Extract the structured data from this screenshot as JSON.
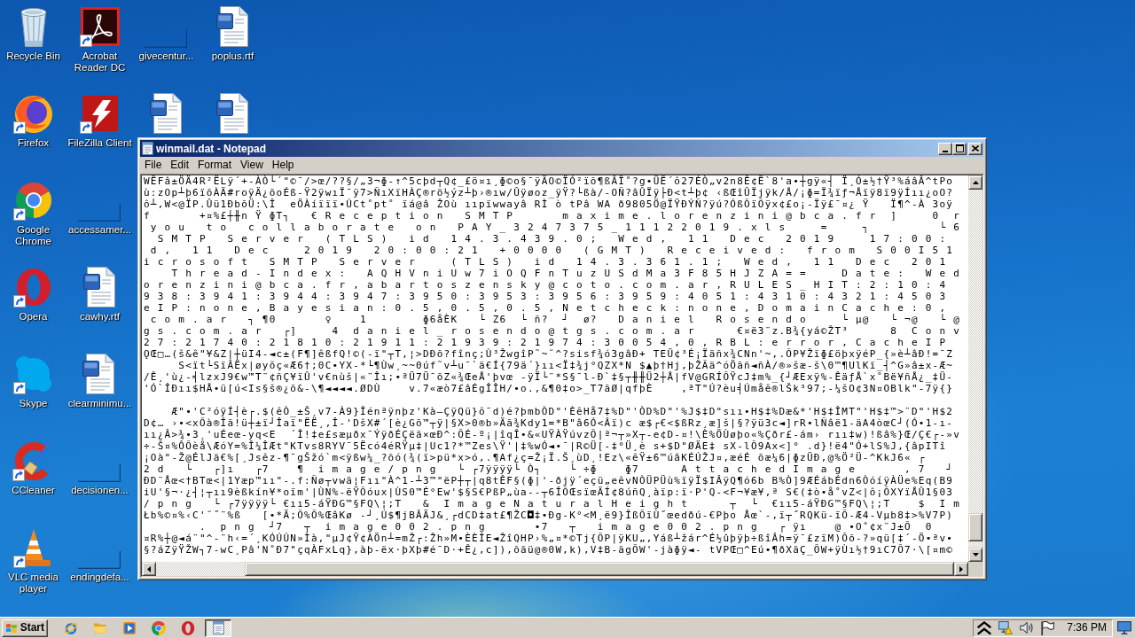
{
  "desktop_columns": [
    {
      "icons": [
        {
          "label": "Recycle Bin",
          "kind": "recycle-bin",
          "shortcut": false
        },
        {
          "label": "Firefox",
          "kind": "firefox",
          "shortcut": true
        },
        {
          "label": "Google Chrome",
          "kind": "chrome",
          "shortcut": true
        },
        {
          "label": "Opera",
          "kind": "opera",
          "shortcut": true
        },
        {
          "label": "Skype",
          "kind": "skype",
          "shortcut": true
        },
        {
          "label": "CCleaner",
          "kind": "ccleaner",
          "shortcut": true
        },
        {
          "label": "VLC media player",
          "kind": "vlc",
          "shortcut": true
        }
      ]
    },
    {
      "icons": [
        {
          "label": "Acrobat Reader DC",
          "kind": "acrobat",
          "shortcut": true
        },
        {
          "label": "FileZilla Client",
          "kind": "filezilla",
          "shortcut": true
        },
        {
          "label": "accessamer...",
          "kind": "blank",
          "shortcut": false
        },
        {
          "label": "cawhy.rtf",
          "kind": "document",
          "shortcut": false
        },
        {
          "label": "clearminimu...",
          "kind": "document",
          "shortcut": false
        },
        {
          "label": "decisionen...",
          "kind": "blank",
          "shortcut": false
        },
        {
          "label": "endingdefa...",
          "kind": "blank",
          "shortcut": false
        }
      ]
    },
    {
      "icons": [
        {
          "label": "givecentur...",
          "kind": "blank",
          "shortcut": false
        },
        {
          "kind": "document",
          "shortcut": false
        }
      ]
    },
    {
      "icons": [
        {
          "label": "poplus.rtf",
          "kind": "document",
          "shortcut": false
        },
        {
          "kind": "document",
          "shortcut": false
        }
      ]
    }
  ],
  "notepad": {
    "title": "winmail.dat - Notepad",
    "menu": [
      "File",
      "Edit",
      "Format",
      "View",
      "Help"
    ],
    "paragraphs": [
      {
        "lines": [
          "WËFâ±ÖÄ4R²ËLÿ´+-ÀÒ└´\"©¯/>œ/??§/„3¬ɸ-↑^5cþd┬Q¢_£ö¤ı¸ɸ©o§¯ÿÄO©ÏÓ²ïõ¶ßÂÏ˚?g•ÜË´ô27ÉÒ„v2n8Ê¢Ë`8'a•┼gÿ«┤ Ï¸Ó±½†Ÿ³%áâÂ^tPo",
          "ù:zOp┴þ6ïõÀÄ#roÿÄ¿õoÉß-Ÿ2ÿwıÏ¯ÿ7>ÑıXïHÀÇ®rö½ýz┴þ›®ıw/Ûÿøoz_ÿŸ?└ßà/-OÑ?âÛÏÿ├Ð<t┴þ¢ ‹ßŒîÛÏjÿk/Å/¡ɸ=Ï¾ïƒ¬Åïÿ8ï9ÿÍıı¿oO?",
          "ô┴,W<@ÏP.Ûü1ÐbõÜ:\\Î  eÖÀíïïï•ÚCt˚pt˚ ïá@â ŽOù ııpïwwayâ RÌ ò tPâ WA ð9805Ö@ÏŸÐÝÑ?ÿú?ÓßÕïÕÿx¢£o¡-Ïÿ£¯¤¿ Ÿ   Ï¶^-À 3oÿ",
          "f       +¤%£┼╫n Ÿ ɸT┐   € R e c e p t i o n   S M T P       m a x i m e . l o r e n z i n i @ b c a . f r  ]     0  r",
          " y o u   t o   c o l l a b o r a t e   o n   P A Y _ 3 2 4 7 3 7 5 _ 1 1 1 2 2 0 1 9 . x l s     =     ┐          └ 6",
          "  S M T P   S e r v e r   ( T L S )   i d   1 4 . 3 . 4 3 9 . 0 ;   W e d ,   1 1   D e c   2 0 1 9     1 7 : 0 0 :",
          " d ,   1 1   D e c     2 0 1 9   2 0 : 0 0 : 2 1   + 0 0 0 0   ( G M T )   R e c e i v e d :   f r o m   S 0 0 I 5 1",
          "i c r o s o f t   S M T P   S e r v e r     ( T L S )   i d   1 4 . 3 . 3 6 1 . 1 ;   W e d ,   1 1   D e c   2 0 1",
          "    T h r e a d - I n d e x :   A Q H V n i U w 7 i O Q F n T u z U S d M a 3 F 8 5 H J Z A = =     D a t e :   W e d",
          "o r e n z i n i @ b c a . f r , a b a r t o s z e n s k y @ c o t o . c o m . a r , R U L E S _ H I T : 2 : 1 0 : 4",
          "9 3 8 : 3 9 4 1 : 3 9 4 4 : 3 9 4 7 : 3 9 5 0 : 3 9 5 3 : 3 9 5 6 : 3 9 5 9 : 4 0 5 1 : 4 3 1 0 : 4 3 2 1 : 4 5 0 3",
          "e I P : n o n e , B a y e s i a n : 0 . 5 , 0 . 5 , 0 . 5 , N e t c h e c k : n o n e , D o m a i n C a c h e : 0 ,",
          " c o m . a r   ┐ ¶0       ♀    1        ɸ6åÈK   └ Z6  └ ñ?  ┘  ø?   D a n i e l   R o s e n d o     └ µ@   └ ¬@   └ @",
          "g s . c o m . a r   ┌]     4  d a n i e l _ r o s e n d o @ t g s . c o m . a r      €¤ë3¨z.B¾{yá©ŽT³      8  C o n v",
          "2 7 : 2 1 7 4 0 : 2 1 8 1 0 : 2 1 9 1 1 : 2 1 9 3 9 : 2 1 9 7 4 : 3 0 0 5 4 , 0 , R B L : e r r o r , C a c h e I P",
          "ǪŒ□…(š&ê\"¥&Z|┼üI4-◄c±(F¶]êßfQ!©(-ï\"┬T,¦>DÐõ?fînç;Ù³ŽwgîP˜~˘^?sisf¾ó3gâÐ+ TEÜ¢³É¡Ïäñx¾CNn'~,.ÕP¥Žïɸ£öþxÿéP_{»è┴âÐ!=¯Z",
          "     S<ït└SïÂËx|øyŏç«Æ6†;0C•YX-*└¶Ùw¸~~0úf˜v┴u¯`ä€Í{79ä´}ıı<Ï‡¾j°QZX*N $▲þ†Hj,þŽÃä^óÖãñ◄ñÀ/®»šæ-š\\0™¶UlKï_┤^G»â±x-Æ~",
          "/Ê¸'ù¿-╡lzxJ9€w™T¨¢ñÇ¥ïÛ'v€nùš|«¨Îı;•ªÜ7Ü¯õZ«¾ŒeÅ'þvœ -ÿÏ└¨*S§¯l-Ð`‡§┬╫╫Ü2┼Å|fV@GRÍÕŸcJ‡m%_{┘ÆExÿ%-ÊäƒÅ`x˚Bë¥ñÅ¿_‡Ü-",
          "'Ó`ÎÐıı$HÅ•ü[ú<Is§š®¿õ&-\\¶◄◄◄◄.ØDÙ    v.7«æò7£âÉgÎÎH/•o.,&¶0‡o>_T7ãØ|qfþÈ    ,ªT\"Ú?èu╡Úmåê®lŠk³97;-¼šO¢3N¤OBlk\"-7ÿ{}"
        ]
      },
      {
        "lines": [
          "    Æ\"•'C²óÿÍ┤è┌.$(êÒ_±Š¸v7-À9}Îénªÿnþz'Kà—ÇÿQü}ô¯d)é?þmbÒD\"'ÈêHå7‡%D\"'ÒD%D\"'%J$‡D\"sıı•H$‡%Dæ&*'H$‡ÎMT\"'H$‡™>¨D\"'H$2",
          "D¢… ›•<xÕà®Îã!ü┼±ï┘Îaï\"ËË¸,Î-'DšX#´[è¿Gõ™┬ÿ|§X>0®b»Äã¾Kdy1=*B\"â6Ó<Âï)c æ$┌€<$ßRz¸æ]š|§?ÿü3c◄]rR•lÑâë1-äA4òœC┘(Ó•1-ı-",
          "ıı¿Â>¾•3¸'uÉeœ-yq<E  ´Î!‡e£sæµðx¯ÝÿðÉÇëä×œÐ^:ÕÉ-º¡|îqÎ•&«UŸÀŸúvzÕ|ª¬┬»X┬-e¢D-¤!\\È%ÖÙøþo«%Çðr£-ám› rıı‡w)!ßâ%}Œ/Ç€┌-»v",
          "÷-Š¤%ÔÕèå\\ÆóY=%Î¼ÎÆt\"KTvs8RYV¯5Ëcó4éRŸµ‡|Uc1?*™Zes\\Ÿ'|‡%wÓ◄•¯|R©Ü[-‡°Ü¸è s+$D\"ØÄE‡ sX-lÕ9Ax<]° .d}!ë4\"Ó+lS%J,{âpITî",
          "¡Oà\"-Ž@ÉlJä€%[¸Jsêz-¶¯gŠžó`m<ÿßw¼_?õó(¾(ï>pü*x>ó,.¶Af¿ç=Ž¡Ï.Š¸ùD¸!Ez\\«êŸ±6™úâKÉÚŽJ¤,æéÉ õæ¼6|ɸzÜÐ,@%Ö²Ü-^KkJ6« ┌",
          "2 d   └   ┌]ı   ┌7    ¶  i m a g e / p n g   └ ┌7ÿÿÿÿ└ Ò┐    └ ÷ɸ    ɸ7      A t t a c h e d I m a g e       , 7   ┘",
          "ÐD¨Åœ<†BTœ<|1Yæp™ıı\"-.f:Ñø┬vwä¦Fıı\"À^1-┴3™\"ëP┼┬|q8tÊF§(ɸ|'-ðjÿ´eçü„eêvNÒÜPÜù%ïÿÏ$IÂÿQ¶ó6b B%Ò]9ÆÉábÉdn6ÒóíÿÀÜe%Eq(B9",
          "iU'§¬·¿┤¦┬ıı9èßkín¥*oïm'|ÙN%-ëŸÕóux|ÙS0™É°Ew'$§S€PßP„ùa--┬6ÎÕŒsïœÄÍ¢8úñQ¸àïp:ï·P'Q-<F¬¥æ¥,ª S€(‡ò•å˚vZ<|ô¡ÕXYïÅÛ1§03",
          "/ p n g   └ ┌7ÿÿÿÿ└ €ıı5-áŸÐG™§FQ\\¦;T   &  I m a g e N a t u r a l H e i g h t      ┬  └  €ıı5-áŸÐG™§FQ\\¦;T    $  I m",
          "Łb%©¤%‹C'˘˝¨%ß   [•*Ä;Õ%Õ%ŒâKø -┘¸Ú$¶jBÂÄJ&¸┌dCD‡at£¶ŽC◘‡•Ðg-K°<M¸ë9}ÎßÕïÙ˝œedðú-€Pþo Åœ`-,ï┬˝RQKü-ïÕ-Æ4-Vµb8‡>%V7P)",
          "        .  p n g  ┘7   ┬  i m a g e 0 0 2 . p n g       •7   ┬   i m a g e 0 0 2 . p n g   ┌ ÿı    @ •O˚¢x¨J±Õ  0",
          "¤R%┼@◄á¨\"^-¨h‹=´¸KÓÚÚN»Ìà,\"µJ¢Ÿ¢ÀÖn┴=mŽ┌:Žh»M•ÈÈÎE◄ŽîQHP›%„¤*©Tj{ÕP|ÿKU„,Yáß┴žár^É½ûþÿþ÷ßîÂh=ÿ¯£zïM)Õõ-?»qü[‡´-Ö•ªv•",
          "§?áZÿŸŽW┐7-wC¸Pâ'N˚Ð7\"çqÀFxLq},àþ-ëx·þXþ#é¯D·+Ê¿,c]),õãü@®0W,k),V‡B-ãgÕW'-jàɸÿ◄- tVPŒ□^Eú•¶ðXãÇ_ÕW+ÿÙı½†9ıC7Õ7·\\[¤m©"
        ]
      }
    ]
  },
  "taskbar": {
    "start": "Start",
    "quick_launch": [
      {
        "kind": "ie"
      },
      {
        "kind": "folder"
      },
      {
        "kind": "media"
      },
      {
        "kind": "chrome"
      },
      {
        "kind": "opera"
      }
    ],
    "tasks": [
      {
        "kind": "notepad",
        "active": true
      }
    ],
    "tray": [
      {
        "kind": "chevron"
      },
      {
        "kind": "network"
      },
      {
        "kind": "speaker"
      },
      {
        "kind": "flag"
      }
    ],
    "clock": "7:36 PM"
  }
}
